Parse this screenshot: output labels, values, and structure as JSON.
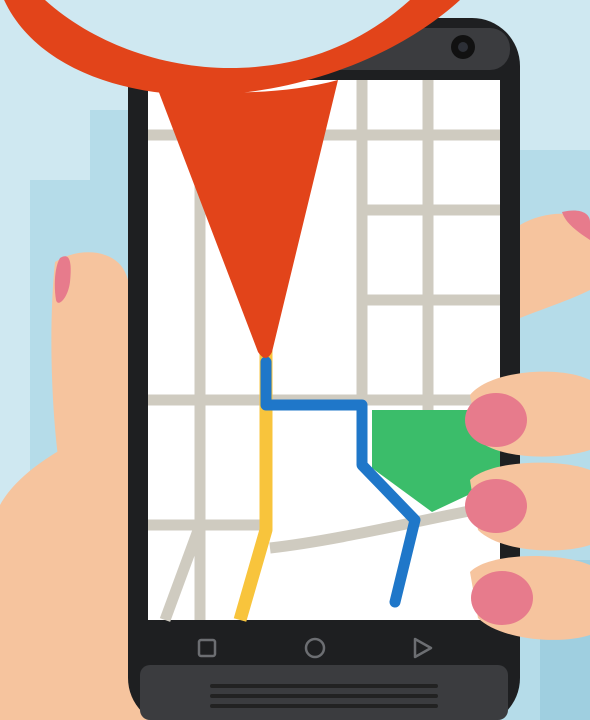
{
  "colors": {
    "sky": "#cfe8f1",
    "building": "#b5dce9",
    "building_dark": "#9fcfe0",
    "skin": "#f6c49e",
    "skin_shadow": "#eab48c",
    "nail": "#e77b8c",
    "phone_body": "#1e1f21",
    "phone_bezel": "#3b3c3f",
    "map_bg": "#ffffff",
    "street": "#cfcbc0",
    "route_blue": "#1f77c9",
    "route_yellow": "#f8c43c",
    "park_green": "#3bbd6a",
    "pin_orange": "#e2441a"
  },
  "icons": {
    "recent": "square-icon",
    "home": "circle-icon",
    "back": "triangle-icon",
    "pin": "map-pin-icon",
    "camera": "camera-icon",
    "speaker": "speaker-grille-icon"
  }
}
